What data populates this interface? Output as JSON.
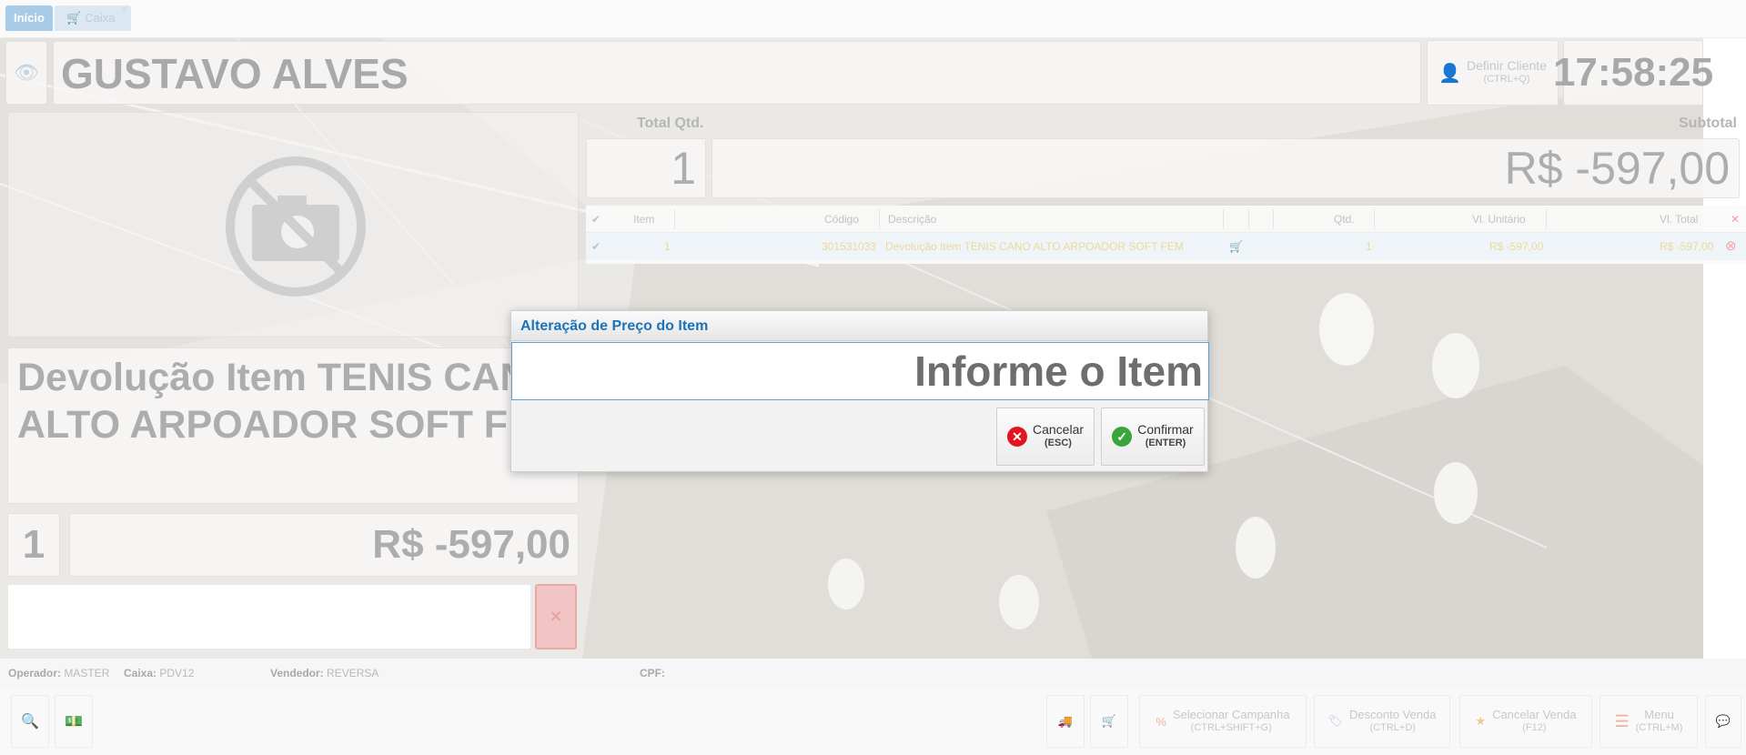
{
  "tabs": [
    {
      "label": "Início"
    },
    {
      "label": "Caixa"
    }
  ],
  "header": {
    "customer_name": "GUSTAVO ALVES",
    "define_client": {
      "label": "Definir Cliente",
      "shortcut": "(CTRL+Q)"
    },
    "clock": "17:58:25"
  },
  "product": {
    "description": "Devolução Item TENIS CANO ALTO ARPOADOR SOFT FEM.",
    "quantity": "1",
    "price": "R$ -597,00"
  },
  "totals": {
    "qty_label": "Total Qtd.",
    "qty_value": "1",
    "subtotal_label": "Subtotal",
    "subtotal_value": "R$ -597,00"
  },
  "grid": {
    "columns": [
      "Item",
      "Código",
      "Descrição",
      "Qtd.",
      "Vl. Unitário",
      "Vl. Total"
    ],
    "rows": [
      {
        "item": "1",
        "codigo": "301531033",
        "descricao": "Devolução Item TENIS CANO ALTO ARPOADOR SOFT FEM",
        "qtd": "1",
        "unitario": "R$ -597,00",
        "total": "R$ -597,00"
      }
    ]
  },
  "status": {
    "operador_label": "Operador:",
    "operador": "MASTER",
    "caixa_label": "Caixa:",
    "caixa": "PDV12",
    "vendedor_label": "Vendedor:",
    "vendedor": "REVERSA",
    "cpf_label": "CPF:"
  },
  "footer": {
    "selecionar_campanha": {
      "label": "Selecionar Campanha",
      "shortcut": "(CTRL+SHIFT+G)"
    },
    "desconto_venda": {
      "label": "Desconto Venda",
      "shortcut": "(CTRL+D)"
    },
    "cancelar_venda": {
      "label": "Cancelar Venda",
      "shortcut": "(F12)"
    },
    "menu": {
      "label": "Menu",
      "shortcut": "(CTRL+M)"
    }
  },
  "modal": {
    "title": "Alteração de Preço do Item",
    "input_value": "Informe o Item",
    "cancel": {
      "label": "Cancelar",
      "shortcut": "(ESC)"
    },
    "confirm": {
      "label": "Confirmar",
      "shortcut": "(ENTER)"
    }
  },
  "colors": {
    "accent": "#1b73b9",
    "cancel": "#e3141f",
    "confirm": "#3aa53a",
    "tab_active": "#a8cbe8"
  }
}
